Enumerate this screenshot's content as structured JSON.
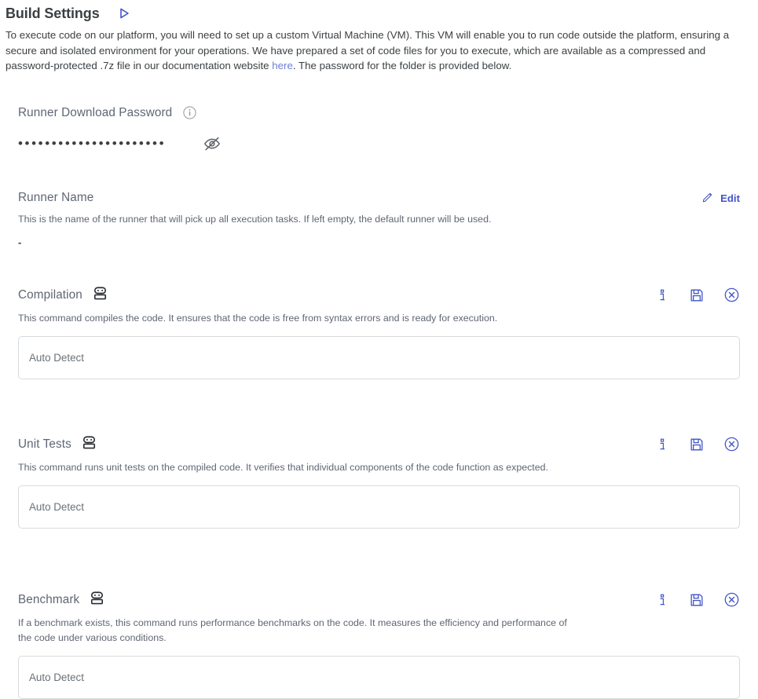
{
  "header": {
    "title": "Build Settings",
    "run_icon": "play-icon"
  },
  "intro": {
    "text_before_link": "To execute code on our platform, you will need to set up a custom Virtual Machine (VM). This VM will enable you to run code outside the platform, ensuring a secure and isolated environment for your operations. We have prepared a set of code files for you to execute, which are available as a compressed and password-protected .7z file in our documentation website ",
    "link_label": "here",
    "text_after_link": ". The password for the folder is provided below."
  },
  "password_section": {
    "label": "Runner Download Password",
    "info_icon": "info-circle-icon",
    "masked_value": "••••••••••••••••••••••",
    "toggle_icon": "eye-off-icon"
  },
  "runner_name_section": {
    "label": "Runner Name",
    "description": "This is the name of the runner that will pick up all execution tasks. If left empty, the default runner will be used.",
    "value": "-",
    "edit_label": "Edit",
    "edit_icon": "pencil-icon"
  },
  "commands": [
    {
      "title": "Compilation",
      "bot_icon": "robot-icon",
      "description": "This command compiles the code. It ensures that the code is free from syntax errors and is ready for execution.",
      "input_placeholder": "Auto Detect",
      "input_value": "",
      "actions": {
        "info": "info-icon",
        "save": "save-floppy-icon",
        "cancel": "cancel-circle-icon"
      }
    },
    {
      "title": "Unit Tests",
      "bot_icon": "robot-icon",
      "description": "This command runs unit tests on the compiled code. It verifies that individual components of the code function as expected.",
      "input_placeholder": "Auto Detect",
      "input_value": "",
      "actions": {
        "info": "info-icon",
        "save": "save-floppy-icon",
        "cancel": "cancel-circle-icon"
      }
    },
    {
      "title": "Benchmark",
      "bot_icon": "robot-icon",
      "description": "If a benchmark exists, this command runs performance benchmarks on the code. It measures the efficiency and performance of the code under various conditions.",
      "input_placeholder": "Auto Detect",
      "input_value": "",
      "actions": {
        "info": "info-icon",
        "save": "save-floppy-icon",
        "cancel": "cancel-circle-icon"
      }
    }
  ],
  "colors": {
    "accent": "#4355c7",
    "link": "#6b7fd4",
    "text": "#3c4043",
    "muted": "#5f6674",
    "border": "#d7dade"
  }
}
